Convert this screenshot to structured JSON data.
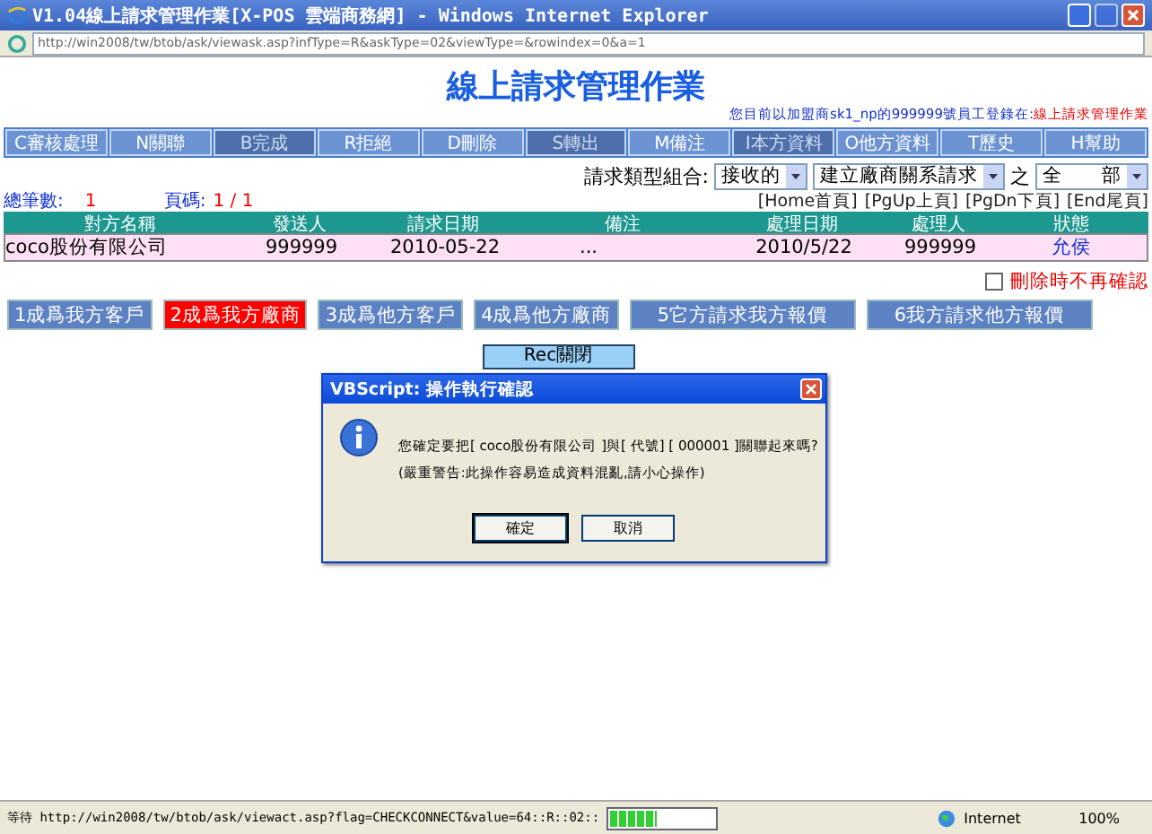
{
  "window": {
    "title": "V1.04線上請求管理作業[X-POS 雲端商務網] - Windows Internet Explorer"
  },
  "address": "http://win2008/tw/btob/ask/viewask.asp?infType=R&askType=02&viewType=&rowindex=0&a=1",
  "page_title": "線上請求管理作業",
  "user_info": {
    "prefix": "您目前以加盟商sk1_np的999999號員工登錄在:",
    "location": "線上請求管理作業"
  },
  "toolbar": [
    {
      "label": "C審核處理",
      "disabled": false
    },
    {
      "label": "N關聯",
      "disabled": false
    },
    {
      "label": "B完成",
      "disabled": true
    },
    {
      "label": "R拒絕",
      "disabled": false
    },
    {
      "label": "D刪除",
      "disabled": false
    },
    {
      "label": "S轉出",
      "disabled": true
    },
    {
      "label": "M備注",
      "disabled": false
    },
    {
      "label": "I本方資料",
      "disabled": true
    },
    {
      "label": "O他方資料",
      "disabled": false
    },
    {
      "label": "T歷史",
      "disabled": false
    },
    {
      "label": "H幫助",
      "disabled": false
    }
  ],
  "filter": {
    "label": "請求類型組合:",
    "selects": [
      "接收的",
      "建立廠商關系請求",
      "全　　部"
    ],
    "joiner": "之"
  },
  "summary": {
    "count_label": "總筆數:",
    "count": "1",
    "page_label": "頁碼:",
    "page": "1 / 1"
  },
  "paging": [
    "[Home首頁]",
    "[PgUp上頁]",
    "[PgDn下頁]",
    "[End尾頁]"
  ],
  "table": {
    "columns": [
      "對方名稱",
      "發送人",
      "請求日期",
      "備注",
      "處理日期",
      "處理人",
      "狀態"
    ],
    "rows": [
      {
        "selected": true,
        "cells": [
          "coco股份有限公司",
          "999999",
          "2010-05-22",
          "...",
          "2010/5/22",
          "999999",
          "允侯"
        ]
      }
    ]
  },
  "no_confirm": {
    "label": "刪除時不再確認",
    "checked": false
  },
  "actions": [
    {
      "label": "1成爲我方客戶",
      "selected": false
    },
    {
      "label": "2成爲我方廠商",
      "selected": true
    },
    {
      "label": "3成爲他方客戶",
      "selected": false
    },
    {
      "label": "4成爲他方廠商",
      "selected": false
    },
    {
      "label": "5它方請求我方報價",
      "selected": false
    },
    {
      "label": "6我方請求他方報價",
      "selected": false
    }
  ],
  "close_button": "Rec關閉",
  "dialog": {
    "title": "VBScript: 操作執行確認",
    "message": "您確定要把[ coco股份有限公司 ]與[ 代號] [ 000001 ]關聯起來嗎?",
    "warning": "(嚴重警告:此操作容易造成資料混亂,請小心操作)",
    "buttons": [
      "確定",
      "取消"
    ]
  },
  "status_bar": {
    "text": "等待 http://win2008/tw/btob/ask/viewact.asp?flag=CHECKCONNECT&value=64::R::02::",
    "progress": {
      "level": 0.45
    },
    "zone": "Internet",
    "zoom": "100%"
  }
}
